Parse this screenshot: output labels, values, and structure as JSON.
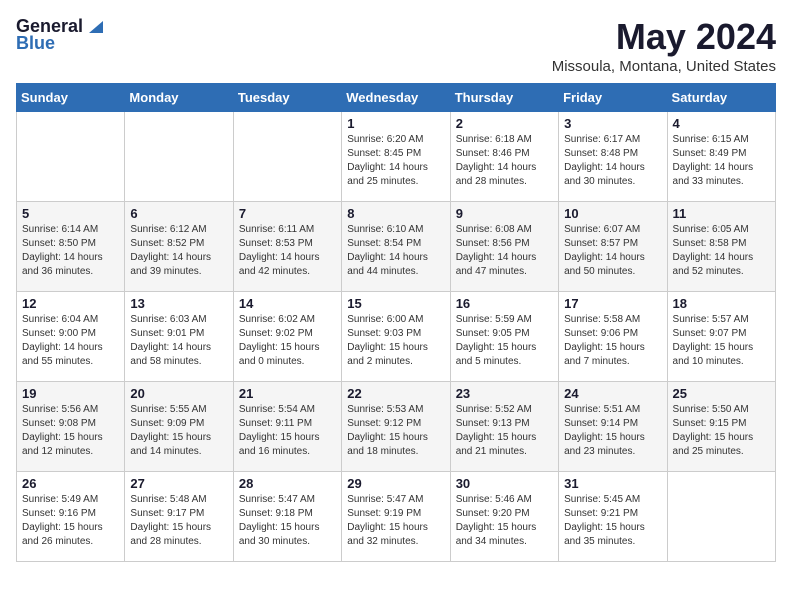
{
  "header": {
    "logo_general": "General",
    "logo_blue": "Blue",
    "month": "May 2024",
    "location": "Missoula, Montana, United States"
  },
  "days_of_week": [
    "Sunday",
    "Monday",
    "Tuesday",
    "Wednesday",
    "Thursday",
    "Friday",
    "Saturday"
  ],
  "weeks": [
    [
      {
        "day": "",
        "info": ""
      },
      {
        "day": "",
        "info": ""
      },
      {
        "day": "",
        "info": ""
      },
      {
        "day": "1",
        "info": "Sunrise: 6:20 AM\nSunset: 8:45 PM\nDaylight: 14 hours\nand 25 minutes."
      },
      {
        "day": "2",
        "info": "Sunrise: 6:18 AM\nSunset: 8:46 PM\nDaylight: 14 hours\nand 28 minutes."
      },
      {
        "day": "3",
        "info": "Sunrise: 6:17 AM\nSunset: 8:48 PM\nDaylight: 14 hours\nand 30 minutes."
      },
      {
        "day": "4",
        "info": "Sunrise: 6:15 AM\nSunset: 8:49 PM\nDaylight: 14 hours\nand 33 minutes."
      }
    ],
    [
      {
        "day": "5",
        "info": "Sunrise: 6:14 AM\nSunset: 8:50 PM\nDaylight: 14 hours\nand 36 minutes."
      },
      {
        "day": "6",
        "info": "Sunrise: 6:12 AM\nSunset: 8:52 PM\nDaylight: 14 hours\nand 39 minutes."
      },
      {
        "day": "7",
        "info": "Sunrise: 6:11 AM\nSunset: 8:53 PM\nDaylight: 14 hours\nand 42 minutes."
      },
      {
        "day": "8",
        "info": "Sunrise: 6:10 AM\nSunset: 8:54 PM\nDaylight: 14 hours\nand 44 minutes."
      },
      {
        "day": "9",
        "info": "Sunrise: 6:08 AM\nSunset: 8:56 PM\nDaylight: 14 hours\nand 47 minutes."
      },
      {
        "day": "10",
        "info": "Sunrise: 6:07 AM\nSunset: 8:57 PM\nDaylight: 14 hours\nand 50 minutes."
      },
      {
        "day": "11",
        "info": "Sunrise: 6:05 AM\nSunset: 8:58 PM\nDaylight: 14 hours\nand 52 minutes."
      }
    ],
    [
      {
        "day": "12",
        "info": "Sunrise: 6:04 AM\nSunset: 9:00 PM\nDaylight: 14 hours\nand 55 minutes."
      },
      {
        "day": "13",
        "info": "Sunrise: 6:03 AM\nSunset: 9:01 PM\nDaylight: 14 hours\nand 58 minutes."
      },
      {
        "day": "14",
        "info": "Sunrise: 6:02 AM\nSunset: 9:02 PM\nDaylight: 15 hours\nand 0 minutes."
      },
      {
        "day": "15",
        "info": "Sunrise: 6:00 AM\nSunset: 9:03 PM\nDaylight: 15 hours\nand 2 minutes."
      },
      {
        "day": "16",
        "info": "Sunrise: 5:59 AM\nSunset: 9:05 PM\nDaylight: 15 hours\nand 5 minutes."
      },
      {
        "day": "17",
        "info": "Sunrise: 5:58 AM\nSunset: 9:06 PM\nDaylight: 15 hours\nand 7 minutes."
      },
      {
        "day": "18",
        "info": "Sunrise: 5:57 AM\nSunset: 9:07 PM\nDaylight: 15 hours\nand 10 minutes."
      }
    ],
    [
      {
        "day": "19",
        "info": "Sunrise: 5:56 AM\nSunset: 9:08 PM\nDaylight: 15 hours\nand 12 minutes."
      },
      {
        "day": "20",
        "info": "Sunrise: 5:55 AM\nSunset: 9:09 PM\nDaylight: 15 hours\nand 14 minutes."
      },
      {
        "day": "21",
        "info": "Sunrise: 5:54 AM\nSunset: 9:11 PM\nDaylight: 15 hours\nand 16 minutes."
      },
      {
        "day": "22",
        "info": "Sunrise: 5:53 AM\nSunset: 9:12 PM\nDaylight: 15 hours\nand 18 minutes."
      },
      {
        "day": "23",
        "info": "Sunrise: 5:52 AM\nSunset: 9:13 PM\nDaylight: 15 hours\nand 21 minutes."
      },
      {
        "day": "24",
        "info": "Sunrise: 5:51 AM\nSunset: 9:14 PM\nDaylight: 15 hours\nand 23 minutes."
      },
      {
        "day": "25",
        "info": "Sunrise: 5:50 AM\nSunset: 9:15 PM\nDaylight: 15 hours\nand 25 minutes."
      }
    ],
    [
      {
        "day": "26",
        "info": "Sunrise: 5:49 AM\nSunset: 9:16 PM\nDaylight: 15 hours\nand 26 minutes."
      },
      {
        "day": "27",
        "info": "Sunrise: 5:48 AM\nSunset: 9:17 PM\nDaylight: 15 hours\nand 28 minutes."
      },
      {
        "day": "28",
        "info": "Sunrise: 5:47 AM\nSunset: 9:18 PM\nDaylight: 15 hours\nand 30 minutes."
      },
      {
        "day": "29",
        "info": "Sunrise: 5:47 AM\nSunset: 9:19 PM\nDaylight: 15 hours\nand 32 minutes."
      },
      {
        "day": "30",
        "info": "Sunrise: 5:46 AM\nSunset: 9:20 PM\nDaylight: 15 hours\nand 34 minutes."
      },
      {
        "day": "31",
        "info": "Sunrise: 5:45 AM\nSunset: 9:21 PM\nDaylight: 15 hours\nand 35 minutes."
      },
      {
        "day": "",
        "info": ""
      }
    ]
  ]
}
